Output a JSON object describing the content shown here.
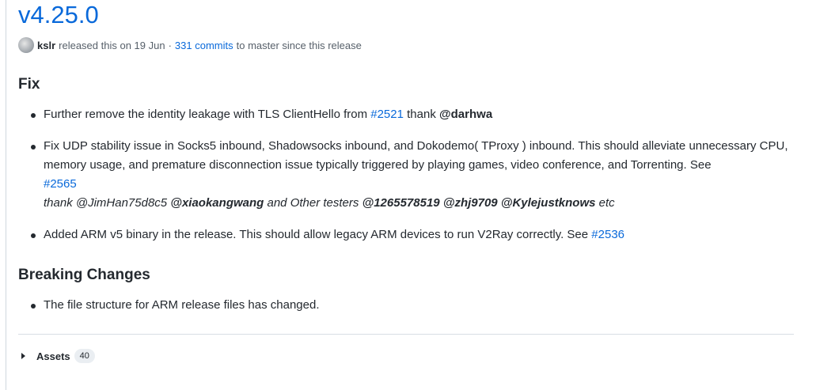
{
  "release": {
    "title": "v4.25.0",
    "author": "kslr",
    "released_text": "released this on 19 Jun",
    "middot": "·",
    "commits_link": "331 commits",
    "commits_suffix": "to master since this release"
  },
  "sections": {
    "fix": {
      "heading": "Fix",
      "item1": {
        "text_a": "Further remove the identity leakage with TLS ClientHello from",
        "link": "#2521",
        "text_b": "thank",
        "mention": "@darhwa"
      },
      "item2": {
        "text": "Fix UDP stability issue in Socks5 inbound, Shadowsocks inbound, and Dokodemo( TProxy ) inbound. This should alleviate unnecessary CPU, memory usage, and premature disconnection issue typically triggered by playing games, video conference, and Torrenting. See",
        "link": "#2565",
        "thank_a": "thank @JimHan75d8c5",
        "mention1": "@xiaokangwang",
        "thank_b": "and Other testers",
        "mention2": "@1265578519",
        "mention3": "@zhj9709",
        "mention4": "@Kylejustknows",
        "thank_c": "etc"
      },
      "item3": {
        "text": "Added ARM v5 binary in the release. This should allow legacy ARM devices to run V2Ray correctly. See",
        "link": "#2536"
      }
    },
    "breaking": {
      "heading": "Breaking Changes",
      "item1": "The file structure for ARM release files has changed."
    }
  },
  "assets": {
    "label": "Assets",
    "count": "40"
  },
  "colors": {
    "link": "#0969da",
    "text": "#24292f",
    "muted": "#57606a"
  }
}
